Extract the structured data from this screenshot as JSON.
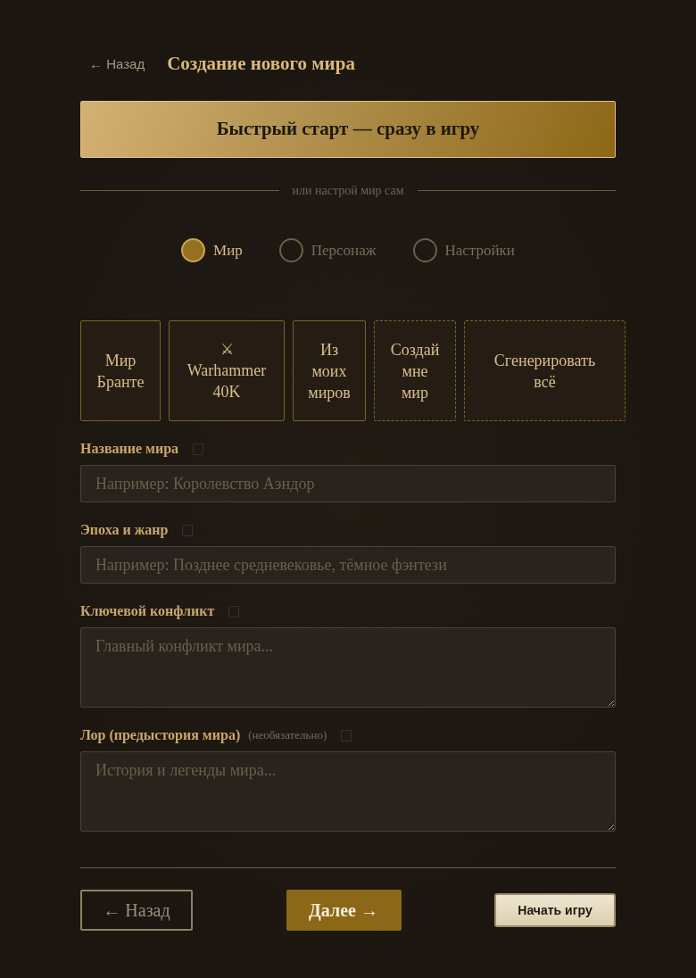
{
  "header": {
    "back_link": "← Назад",
    "title": "Создание нового мира"
  },
  "quick_start": {
    "label": "Быстрый старт — сразу в игру"
  },
  "divider": {
    "text": "или настрой мир сам"
  },
  "steps": [
    {
      "label": "Мир",
      "selected": true
    },
    {
      "label": "Персонаж",
      "selected": false
    },
    {
      "label": "Настройки",
      "selected": false
    }
  ],
  "world_presets": [
    {
      "kind": "preset",
      "label": "Мир Бранте"
    },
    {
      "kind": "preset",
      "icon": "⚔",
      "label": "Warhammer 40K"
    },
    {
      "kind": "preset",
      "label": "Из моих миров"
    },
    {
      "kind": "custom",
      "label": "Создай мне мир"
    },
    {
      "kind": "custom",
      "label": "Сгенерировать всё"
    }
  ],
  "fields": [
    {
      "kind": "input",
      "label": "Название мира",
      "placeholder": "Например: Королевство Аэндор"
    },
    {
      "kind": "input",
      "label": "Эпоха и жанр",
      "placeholder": "Например: Позднее средневековье, тёмное фэнтези"
    },
    {
      "kind": "textarea",
      "label": "Ключевой конфликт",
      "placeholder": "Главный конфликт мира..."
    },
    {
      "kind": "textarea",
      "label": "Лор (предыстория мира)",
      "note": "(необязательно)",
      "placeholder": "История и легенды мира..."
    }
  ],
  "footer": {
    "back_button": "← Назад",
    "next_button": "Далее →",
    "start_button": "Начать игру"
  }
}
